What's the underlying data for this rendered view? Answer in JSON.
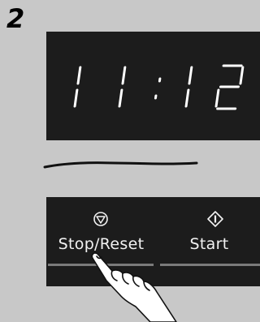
{
  "step": {
    "number": "2"
  },
  "display": {
    "time": "11:12"
  },
  "buttons": {
    "stop_reset": {
      "label": "Stop/Reset",
      "icon": "stop-icon"
    },
    "start": {
      "label": "Start",
      "icon": "start-icon"
    }
  },
  "colors": {
    "background": "#c8c8c8",
    "panel": "#1c1c1c",
    "segment": "#ffffff",
    "label": "#f2f2f2"
  }
}
